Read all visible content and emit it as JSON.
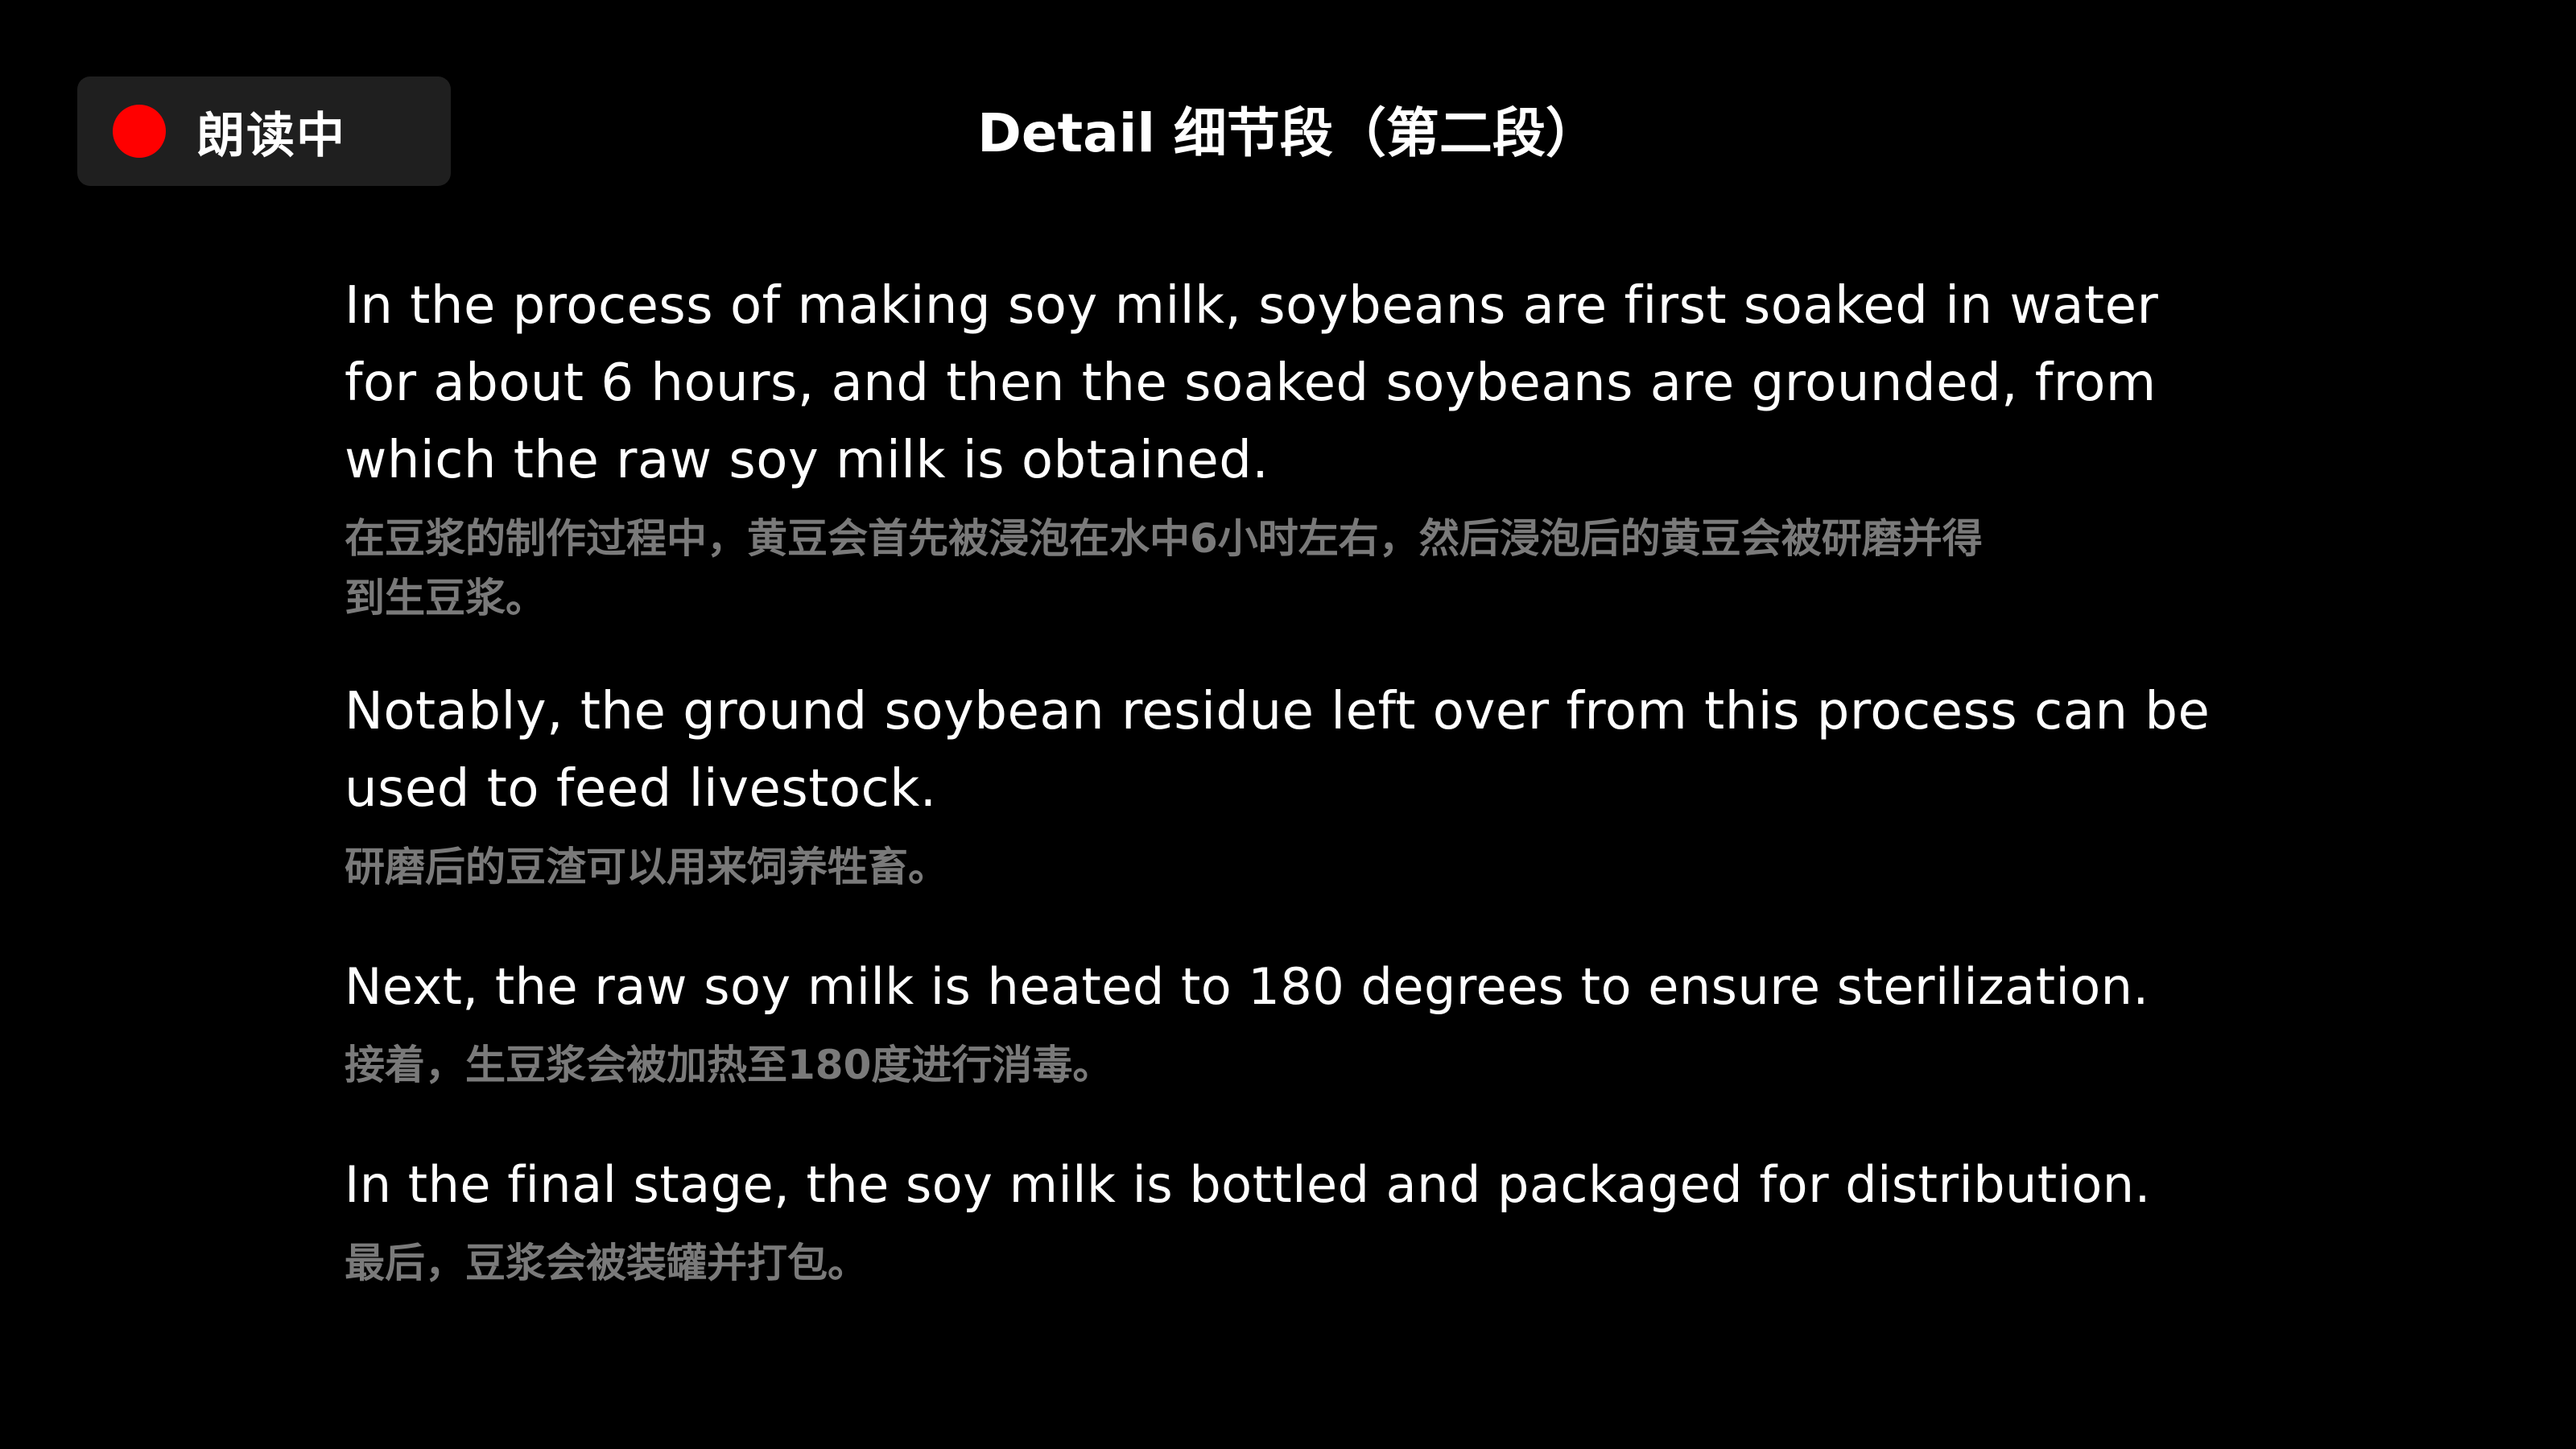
{
  "status_badge": {
    "label": "朗读中",
    "indicator_color": "#ff0000",
    "icon": "record-dot-icon"
  },
  "title": "Detail 细节段（第二段）",
  "paragraphs": [
    {
      "english": "In the process of making soy milk, soybeans are first soaked in water for about 6 hours, and then the soaked soybeans are grounded, from which the raw soy milk is obtained.",
      "chinese": "在豆浆的制作过程中，黄豆会首先被浸泡在水中6小时左右，然后浸泡后的黄豆会被研磨并得到生豆浆。"
    },
    {
      "english": "Notably, the ground soybean residue left over from this process can be used to feed livestock.",
      "chinese": "研磨后的豆渣可以用来饲养牲畜。"
    },
    {
      "english": "Next, the raw soy milk is heated to 180 degrees to ensure sterilization.",
      "chinese": "接着，生豆浆会被加热至180度进行消毒。"
    },
    {
      "english": "In the final stage, the soy milk is bottled and packaged for distribution.",
      "chinese": "最后，豆浆会被装罐并打包。"
    }
  ],
  "colors": {
    "background": "#000000",
    "english_text": "#ffffff",
    "chinese_text": "#7a7a7a",
    "badge_background": "#1f1f1f"
  }
}
